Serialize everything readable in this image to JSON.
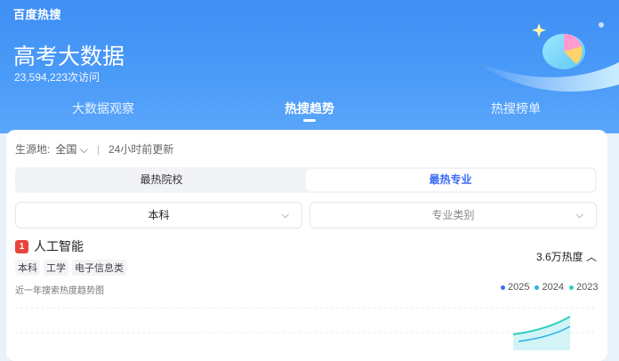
{
  "brand": "百度热搜",
  "header": {
    "title": "高考大数据",
    "visits": "23,594,223次访问"
  },
  "tabs": [
    {
      "label": "大数据观察",
      "active": false
    },
    {
      "label": "热搜趋势",
      "active": true
    },
    {
      "label": "热搜榜单",
      "active": false
    }
  ],
  "filters": {
    "origin_label": "生源地:",
    "origin_value": "全国",
    "update_text": "24小时前更新"
  },
  "segment": {
    "left": "最热院校",
    "right": "最热专业"
  },
  "selects": {
    "level": "本科",
    "category_placeholder": "专业类别"
  },
  "item": {
    "rank": "1",
    "name": "人工智能",
    "tags": [
      "本科",
      "工学",
      "电子信息类"
    ],
    "heat": "3.6万热度"
  },
  "trend": {
    "label": "近一年搜索热度趋势图",
    "legend": [
      {
        "label": "2025",
        "color": "#3a6bf5"
      },
      {
        "label": "2024",
        "color": "#2ab0e8"
      },
      {
        "label": "2023",
        "color": "#2ecfc0"
      }
    ]
  },
  "colors": {
    "hero": "#4b9bf8",
    "accent": "#3a6bf5",
    "rank": "#e8453c"
  }
}
